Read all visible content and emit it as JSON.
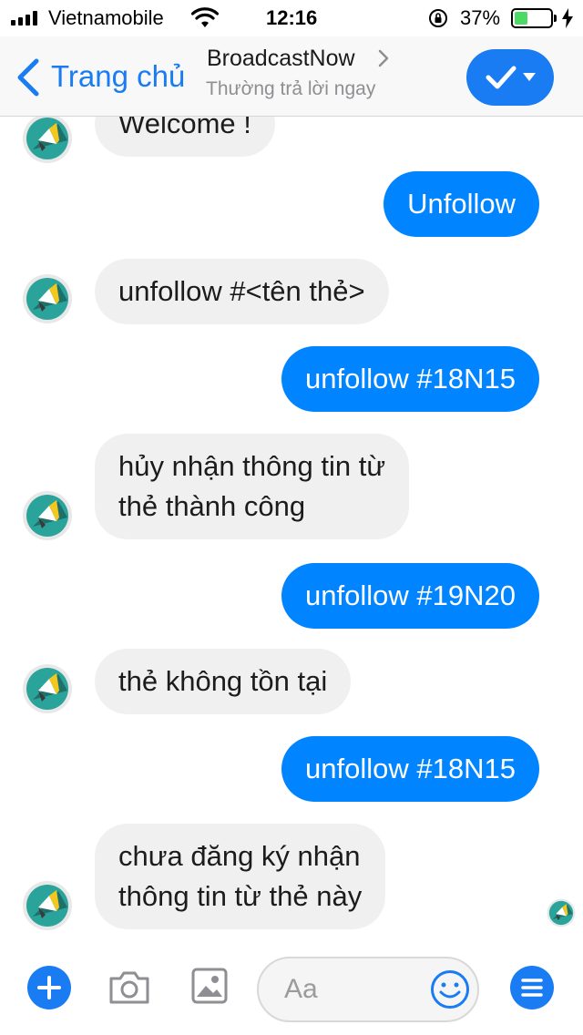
{
  "status_bar": {
    "carrier": "Vietnamobile",
    "time": "12:16",
    "battery_percent": "37%",
    "battery_level": 0.37
  },
  "nav": {
    "back_label": "Trang chủ",
    "title": "BroadcastNow",
    "subtitle": "Thường trả lời ngay",
    "action_icon": "check-dropdown-icon"
  },
  "messages": [
    {
      "from": "bot",
      "lines": [
        "Welcome !"
      ]
    },
    {
      "from": "me",
      "lines": [
        "Unfollow"
      ]
    },
    {
      "from": "bot",
      "lines": [
        "unfollow #<tên thẻ>"
      ]
    },
    {
      "from": "me",
      "lines": [
        "unfollow #18N15"
      ]
    },
    {
      "from": "bot",
      "lines": [
        "hủy nhận thông tin từ",
        "thẻ thành công"
      ]
    },
    {
      "from": "me",
      "lines": [
        "unfollow #19N20"
      ]
    },
    {
      "from": "bot",
      "lines": [
        "thẻ không tồn tại"
      ]
    },
    {
      "from": "me",
      "lines": [
        "unfollow #18N15"
      ]
    },
    {
      "from": "bot",
      "lines": [
        "chưa đăng ký nhận",
        "thông tin từ thẻ này"
      ]
    }
  ],
  "composer": {
    "placeholder": "Aa"
  },
  "colors": {
    "accent": "#1a7cf2",
    "outgoing_bubble": "#0084ff",
    "incoming_bubble": "#f1f0f0",
    "avatar_bg": "#2aa39a"
  }
}
